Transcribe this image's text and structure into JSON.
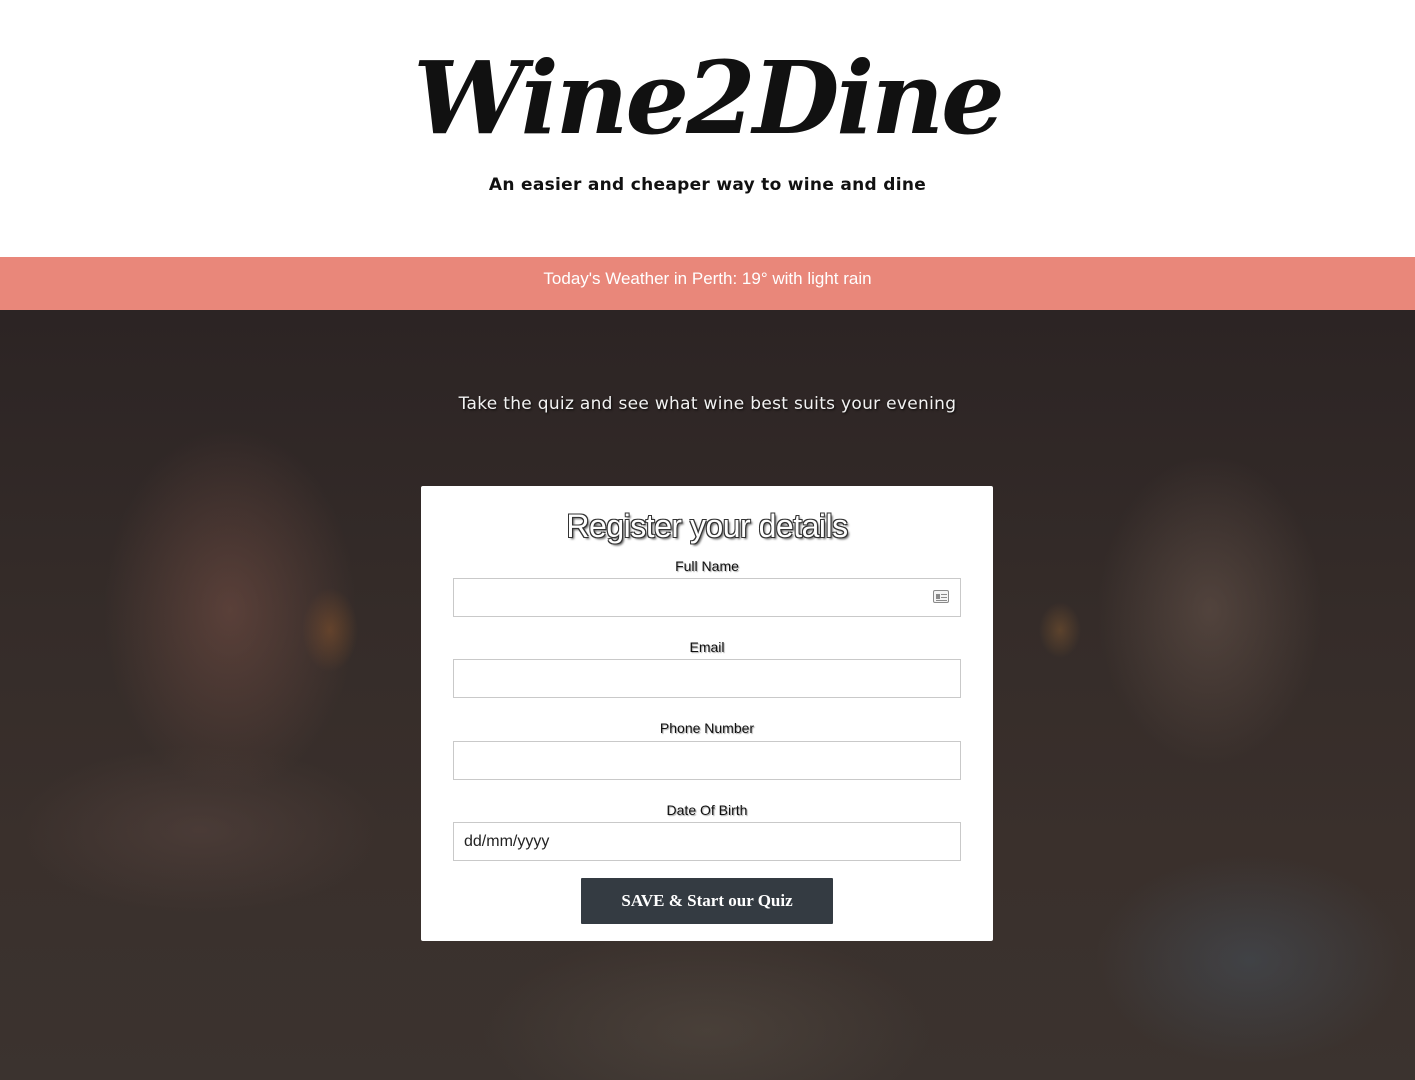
{
  "header": {
    "logo": "Wine2Dine",
    "tagline": "An easier and cheaper way to wine and dine"
  },
  "weather_bar": {
    "text": "Today's Weather in Perth: 19° with light rain",
    "background_color": "#e9877a"
  },
  "hero": {
    "intro": "Take the quiz and see what wine best suits your evening"
  },
  "form": {
    "title": "Register your details",
    "fields": [
      {
        "label": "Full Name",
        "value": "",
        "placeholder": "",
        "icon": "contact-card-icon"
      },
      {
        "label": "Email",
        "value": "",
        "placeholder": ""
      },
      {
        "label": "Phone Number",
        "value": "",
        "placeholder": ""
      },
      {
        "label": "Date Of Birth",
        "value": "",
        "placeholder": "dd/mm/yyyy"
      }
    ],
    "submit_label": "SAVE & Start our Quiz",
    "submit_color": "#343b42"
  }
}
